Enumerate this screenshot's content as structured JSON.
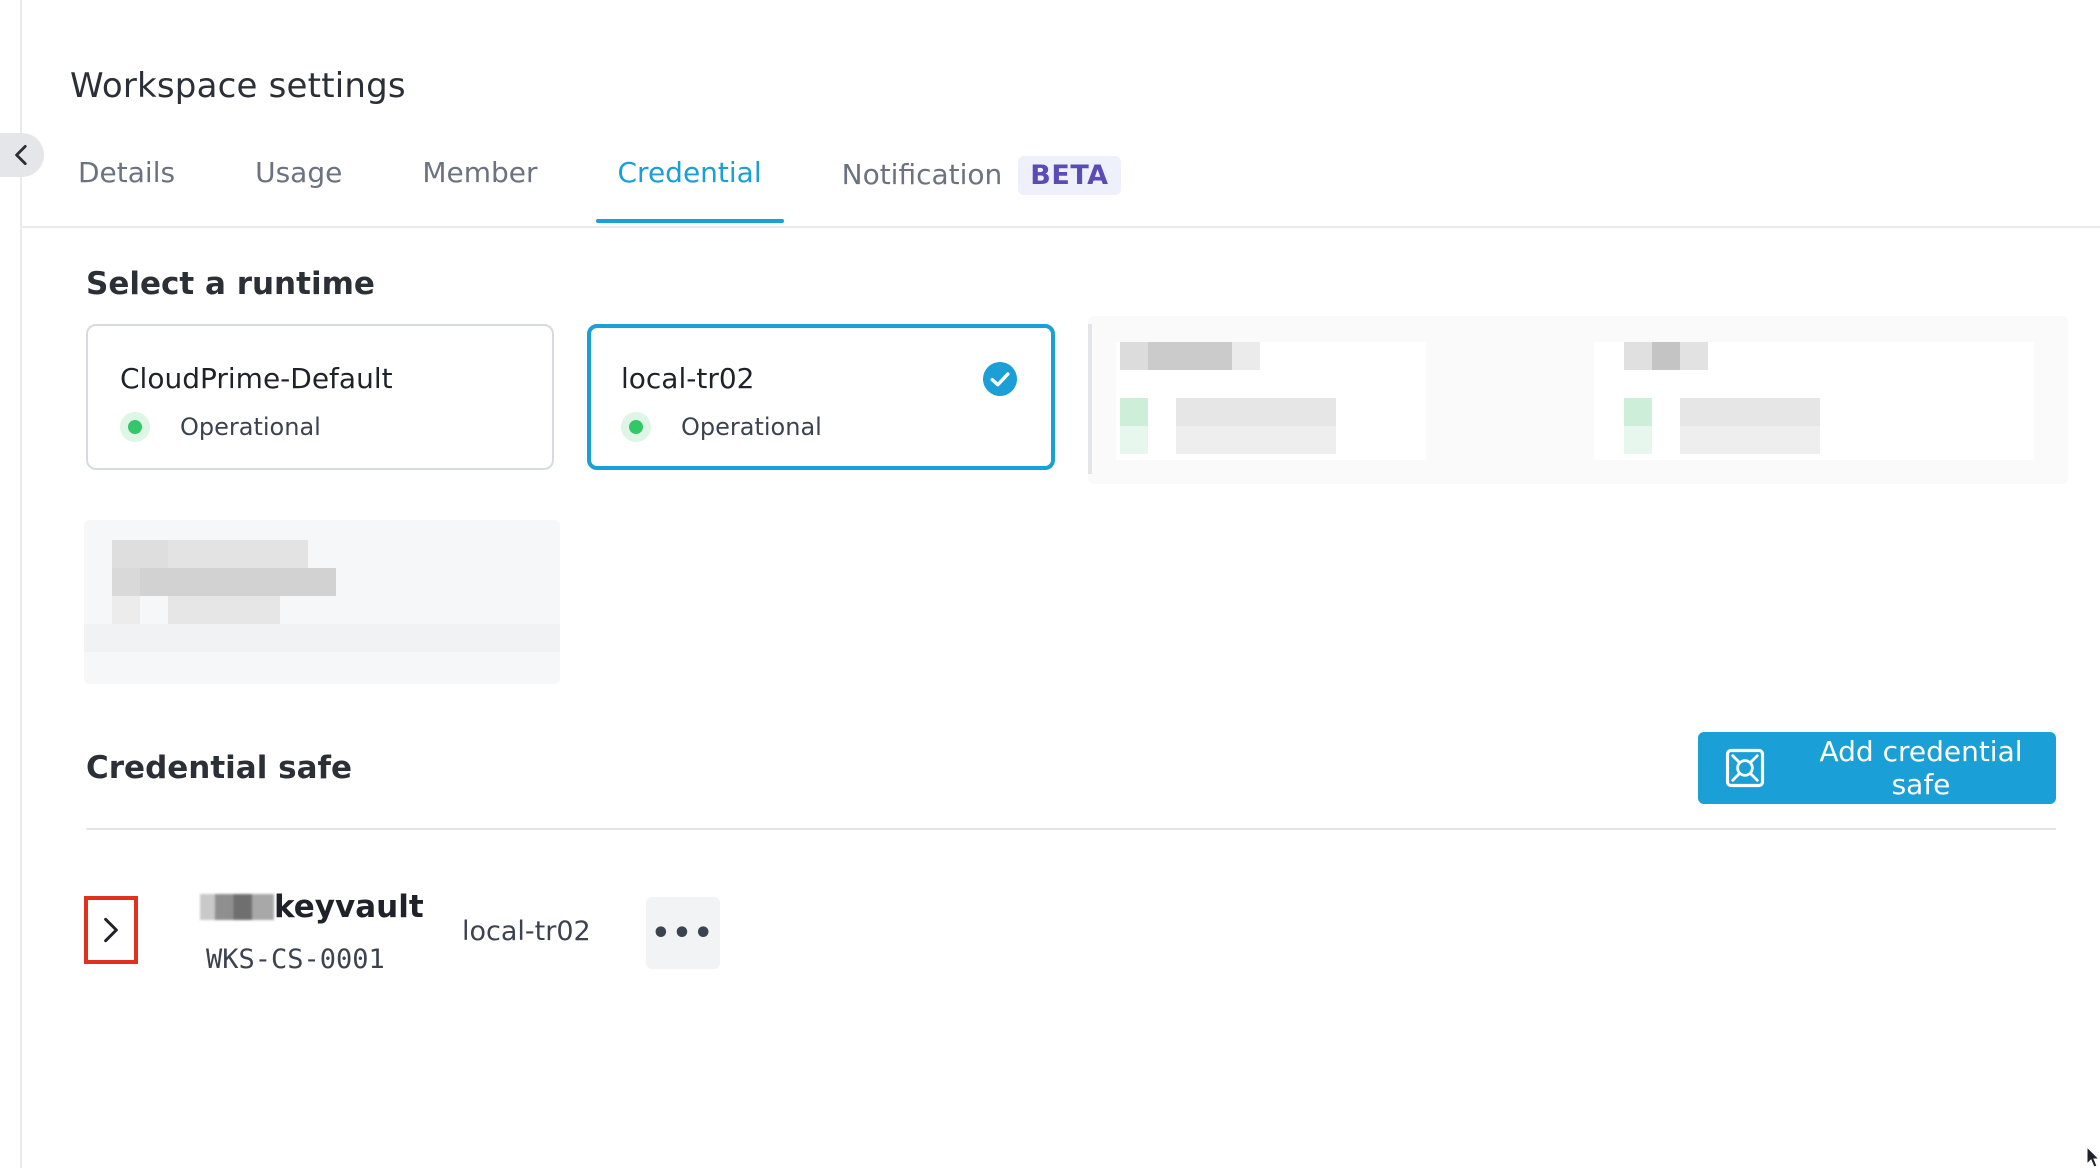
{
  "page": {
    "title": "Workspace settings"
  },
  "tabs": [
    {
      "label": "Details",
      "active": false
    },
    {
      "label": "Usage",
      "active": false
    },
    {
      "label": "Member",
      "active": false
    },
    {
      "label": "Credential",
      "active": true
    },
    {
      "label": "Notification",
      "active": false,
      "badge": "BETA"
    }
  ],
  "runtime_section": {
    "title": "Select a runtime",
    "runtimes": [
      {
        "name": "CloudPrime-Default",
        "status": "Operational",
        "selected": false
      },
      {
        "name": "local-tr02",
        "status": "Operational",
        "selected": true
      }
    ]
  },
  "credential_safe": {
    "title": "Credential safe",
    "add_button_label": "Add credential safe",
    "rows": [
      {
        "name": "keyvault",
        "id": "WKS-CS-0001",
        "runtime": "local-tr02",
        "more_label": "•••"
      }
    ]
  },
  "colors": {
    "accent": "#1a9fd6",
    "status_ok": "#34c768",
    "badge_text": "#5b4bb5",
    "highlight_outline": "#e0301e"
  },
  "icons": {
    "collapse": "chevron-left-icon",
    "selected": "check-circle-icon",
    "add": "credential-safe-icon",
    "expand": "chevron-right-icon",
    "more": "more-horizontal-icon"
  }
}
